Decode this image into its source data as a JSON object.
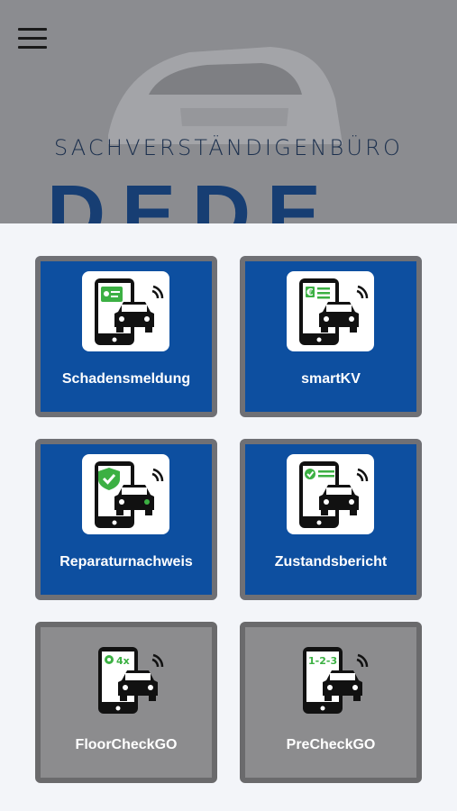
{
  "header": {
    "menu_icon": "hamburger-menu-icon",
    "subtitle": "SACHVERSTÄNDIGENBÜRO",
    "brand": "DEDE"
  },
  "tiles": [
    {
      "label": "Schadensmeldung",
      "icon": "phone-car-id-card-icon"
    },
    {
      "label": "smartKV",
      "icon": "phone-car-euro-icon"
    },
    {
      "label": "Reparaturnachweis",
      "icon": "phone-car-shield-check-icon"
    },
    {
      "label": "Zustandsbericht",
      "icon": "phone-car-checklist-icon"
    },
    {
      "label": "FloorCheckGO",
      "icon": "phone-car-4x-icon",
      "badge": "4x"
    },
    {
      "label": "PreCheckGO",
      "icon": "phone-car-123-icon",
      "badge": "1-2-3"
    }
  ],
  "colors": {
    "tile_active": "#0d4fa0",
    "tile_inactive": "#8c8c8e",
    "accent_green": "#3cb043",
    "brand_blue": "#173e73"
  }
}
